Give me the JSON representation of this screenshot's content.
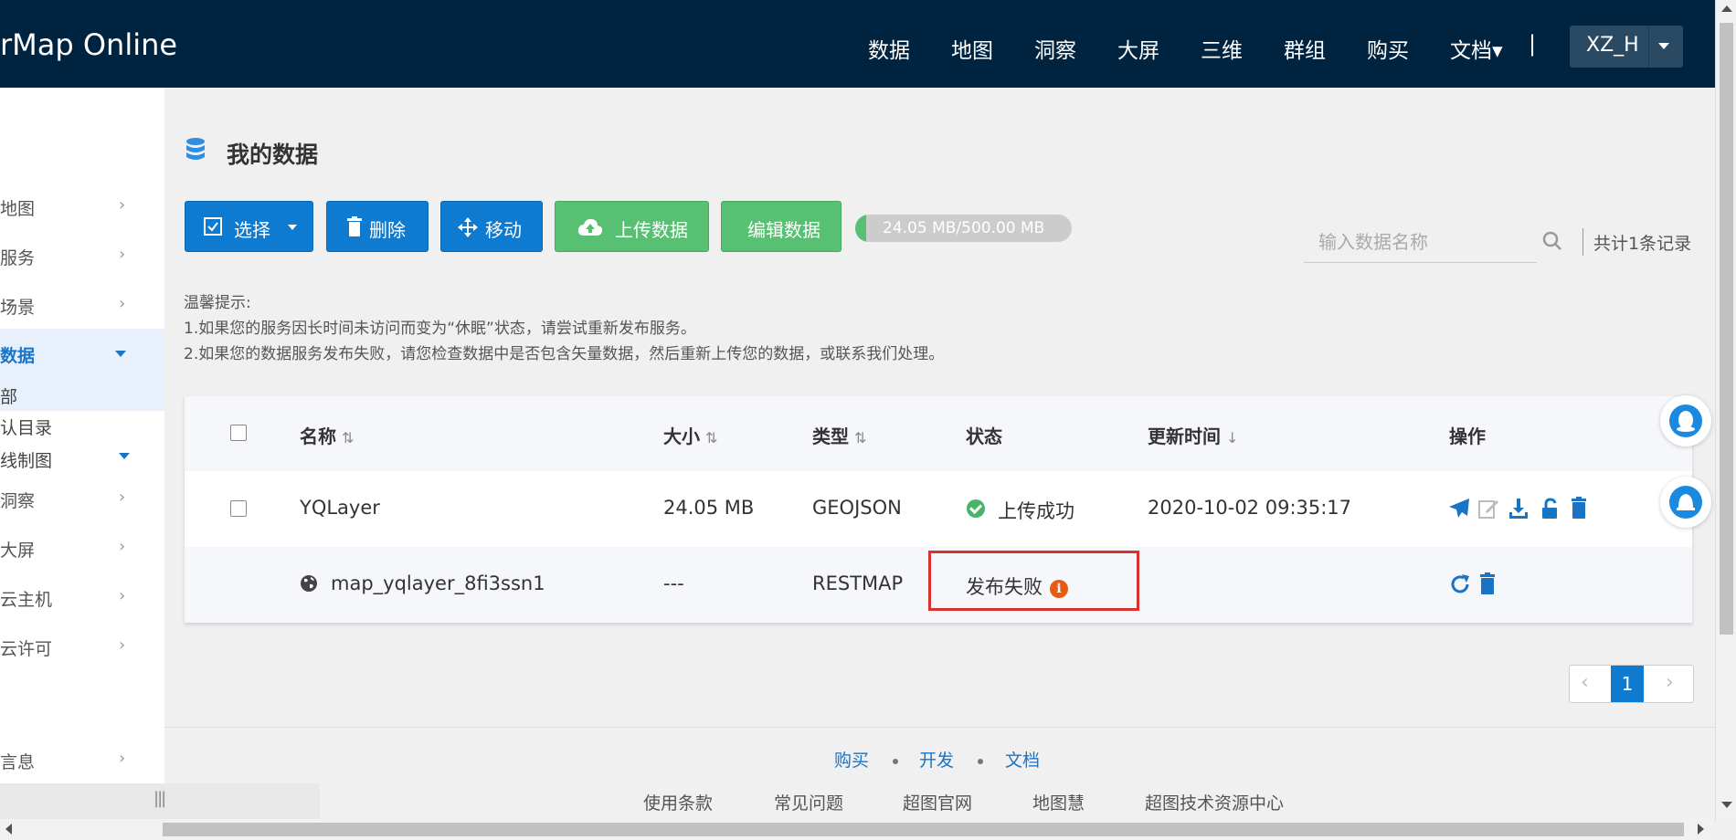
{
  "header": {
    "brand": "rMap Online",
    "nav": [
      "数据",
      "地图",
      "洞察",
      "大屏",
      "三维",
      "群组",
      "购买",
      "文档▾"
    ],
    "separator": "|",
    "user": "XZ_H"
  },
  "sidebar": {
    "items": [
      {
        "label": "地图"
      },
      {
        "label": "服务"
      },
      {
        "label": "场景"
      },
      {
        "label": "数据"
      },
      {
        "label": "洞察"
      },
      {
        "label": "大屏"
      },
      {
        "label": "云主机"
      },
      {
        "label": "云许可"
      },
      {
        "label": "言息"
      }
    ],
    "sub_items": [
      "部",
      "认目录",
      "线制图"
    ]
  },
  "main": {
    "title": "我的数据",
    "toolbar": {
      "select": "选择",
      "delete": "删除",
      "move": "移动",
      "upload": "上传数据",
      "edit": "编辑数据"
    },
    "storage": {
      "label": "24.05 MB/500.00 MB",
      "used_fraction": 0.048
    },
    "search": {
      "placeholder": "输入数据名称"
    },
    "count": "共计1条记录",
    "tips": [
      "温馨提示:",
      "1.如果您的服务因长时间未访问而变为“休眠”状态，请尝试重新发布服务。",
      "2.如果您的数据服务发布失败，请您检查数据中是否包含矢量数据，然后重新上传您的数据，或联系我们处理。"
    ]
  },
  "table": {
    "columns": {
      "name": "名称",
      "size": "大小",
      "type": "类型",
      "status": "状态",
      "updated": "更新时间",
      "actions": "操作"
    },
    "rows": [
      {
        "name": "YQLayer",
        "size": "24.05 MB",
        "type": "GEOJSON",
        "status": "上传成功",
        "updated": "2020-10-02 09:35:17"
      },
      {
        "name": "map_yqlayer_8fi3ssn1",
        "size": "---",
        "type": "RESTMAP",
        "status": "发布失败",
        "updated": ""
      }
    ]
  },
  "pager": {
    "current": "1"
  },
  "footer": {
    "links1": [
      "购买",
      "开发",
      "文档"
    ],
    "links2": [
      "使用条款",
      "常见问题",
      "超图官网",
      "地图慧",
      "超图技术资源中心"
    ]
  },
  "colors": {
    "nav_bg": "#00233f",
    "primary": "#0f7bd0",
    "success": "#57c072",
    "error": "#e85a12",
    "highlight": "#d93030"
  }
}
